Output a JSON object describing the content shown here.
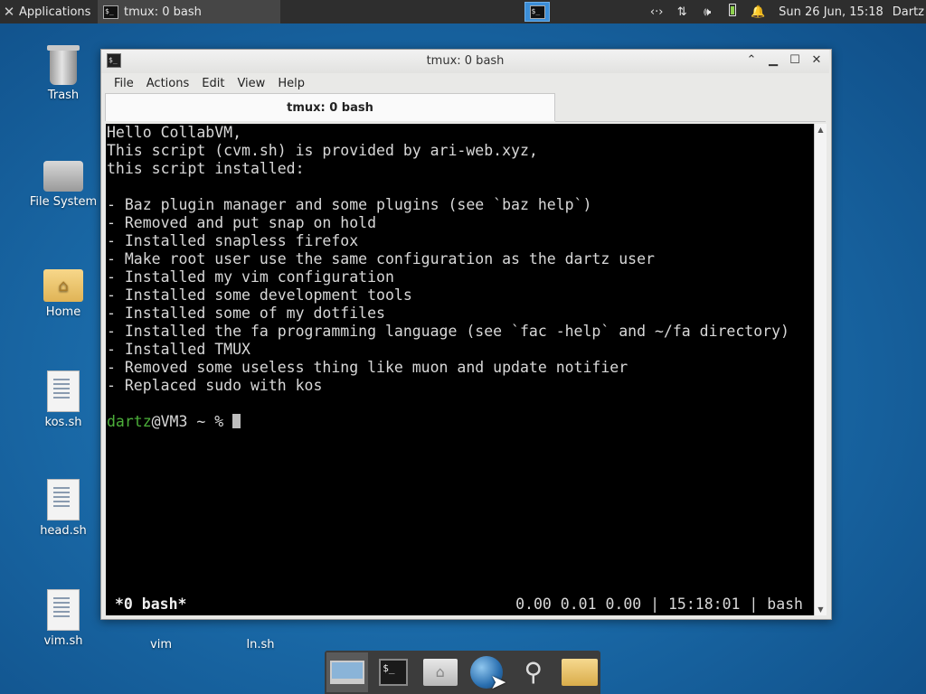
{
  "top_panel": {
    "applications_label": "Applications",
    "task_title": "tmux: 0 bash",
    "datetime": "Sun 26 Jun, 15:18",
    "user": "Dartz",
    "tray_icons": [
      "network-icon",
      "updown-icon",
      "volume-icon",
      "battery-icon",
      "notification-bell-icon"
    ]
  },
  "desktop": {
    "icons": [
      {
        "label": "Trash",
        "icon": "trash-icon"
      },
      {
        "label": "File System",
        "icon": "drive-icon"
      },
      {
        "label": "Home",
        "icon": "home-folder-icon"
      },
      {
        "label": "kos.sh",
        "icon": "script-file-icon"
      },
      {
        "label": "head.sh",
        "icon": "script-file-icon"
      },
      {
        "label": "vim.sh",
        "icon": "script-file-icon"
      },
      {
        "label": "vim",
        "icon": "folder-icon"
      },
      {
        "label": "ln.sh",
        "icon": "script-file-icon"
      }
    ]
  },
  "window": {
    "title": "tmux: 0 bash",
    "menu": [
      "File",
      "Actions",
      "Edit",
      "View",
      "Help"
    ],
    "tab_label": "tmux: 0 bash",
    "terminal_lines": [
      "Hello CollabVM,",
      "This script (cvm.sh) is provided by ari-web.xyz,",
      "this script installed:",
      "",
      "- Baz plugin manager and some plugins (see `baz help`)",
      "- Removed and put snap on hold",
      "- Installed snapless firefox",
      "- Make root user use the same configuration as the dartz user",
      "- Installed my vim configuration",
      "- Installed some development tools",
      "- Installed some of my dotfiles",
      "- Installed the fa programming language (see `fac -help` and ~/fa directory)",
      "- Installed TMUX",
      "- Removed some useless thing like muon and update notifier",
      "- Replaced sudo with kos",
      ""
    ],
    "prompt": {
      "user": "dartz",
      "rest": "@VM3 ~ % "
    },
    "status_left": "*0 bash*",
    "status_right": "0.00 0.01 0.00 | 15:18:01 | bash"
  },
  "dock": {
    "items": [
      "show-desktop-icon",
      "terminal-icon",
      "home-folder-icon",
      "web-browser-icon",
      "search-icon",
      "folder-icon"
    ],
    "terminal_glyph": "$_"
  }
}
